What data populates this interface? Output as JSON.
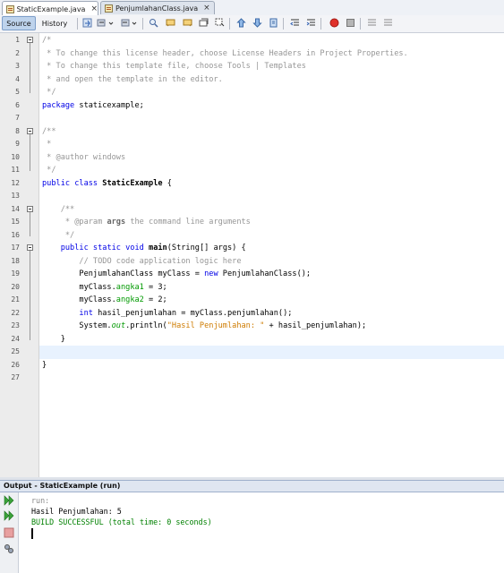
{
  "tabs": [
    {
      "label": "StaticExample.java",
      "close": "×",
      "active": true
    },
    {
      "label": "PenjumlahanClass.java",
      "close": "×",
      "active": false
    }
  ],
  "toolbar": {
    "source_label": "Source",
    "history_label": "History"
  },
  "editor": {
    "lines": [
      {
        "n": "1",
        "html": "<span class='c-com'>/*</span>"
      },
      {
        "n": "2",
        "html": "<span class='c-com'> * To change this license header, choose License Headers in Project Properties.</span>"
      },
      {
        "n": "3",
        "html": "<span class='c-com'> * To change this template file, choose Tools | Templates</span>"
      },
      {
        "n": "4",
        "html": "<span class='c-com'> * and open the template in the editor.</span>"
      },
      {
        "n": "5",
        "html": "<span class='c-com'> */</span>"
      },
      {
        "n": "6",
        "html": "<span class='c-kw'>package</span> staticexample;"
      },
      {
        "n": "7",
        "html": ""
      },
      {
        "n": "8",
        "html": "<span class='c-com'>/**</span>"
      },
      {
        "n": "9",
        "html": "<span class='c-com'> *</span>"
      },
      {
        "n": "10",
        "html": "<span class='c-com'> * @author windows</span>"
      },
      {
        "n": "11",
        "html": "<span class='c-com'> */</span>"
      },
      {
        "n": "12",
        "html": "<span class='c-kw'>public class</span> <span class='c-b'>StaticExample</span> {"
      },
      {
        "n": "13",
        "html": ""
      },
      {
        "n": "14",
        "html": "    <span class='c-com'>/**</span>"
      },
      {
        "n": "15",
        "html": "<span class='c-com'>     * @param </span><span class='c-b' style='color:#666'>args</span><span class='c-com'> the command line arguments</span>"
      },
      {
        "n": "16",
        "html": "<span class='c-com'>     */</span>"
      },
      {
        "n": "17",
        "html": "    <span class='c-kw'>public static void</span> <span class='c-b'>main</span>(String[] args) {"
      },
      {
        "n": "18",
        "html": "        <span class='c-com'>// TODO code application logic here</span>"
      },
      {
        "n": "19",
        "html": "        PenjumlahanClass myClass = <span class='c-kw'>new</span> PenjumlahanClass();"
      },
      {
        "n": "20",
        "html": "        myClass.<span class='c-fld'>angka1</span> = 3;"
      },
      {
        "n": "21",
        "html": "        myClass.<span class='c-fld'>angka2</span> = 2;"
      },
      {
        "n": "22",
        "html": "        <span class='c-kw'>int</span> hasil_penjumlahan = myClass.penjumlahan();"
      },
      {
        "n": "23",
        "html": "        System.<span class='c-fld c-it'>out</span>.println(<span class='c-str'>\"Hasil Penjumlahan: \"</span> + hasil_penjumlahan);"
      },
      {
        "n": "24",
        "html": "    }"
      },
      {
        "n": "25",
        "html": ""
      },
      {
        "n": "26",
        "html": "}"
      },
      {
        "n": "27",
        "html": ""
      }
    ]
  },
  "output": {
    "title": "Output - StaticExample (run)",
    "lines": [
      {
        "text": "run:",
        "kind": "grey"
      },
      {
        "text": "Hasil Penjumlahan: 5",
        "kind": "black"
      },
      {
        "text": "BUILD SUCCESSFUL (total time: 0 seconds)",
        "kind": "green"
      }
    ]
  },
  "colors": {
    "keyword": "#0000e6",
    "comment": "#969696",
    "field": "#009900",
    "string": "#ce7b00",
    "current_line": "#e8f2fe"
  }
}
